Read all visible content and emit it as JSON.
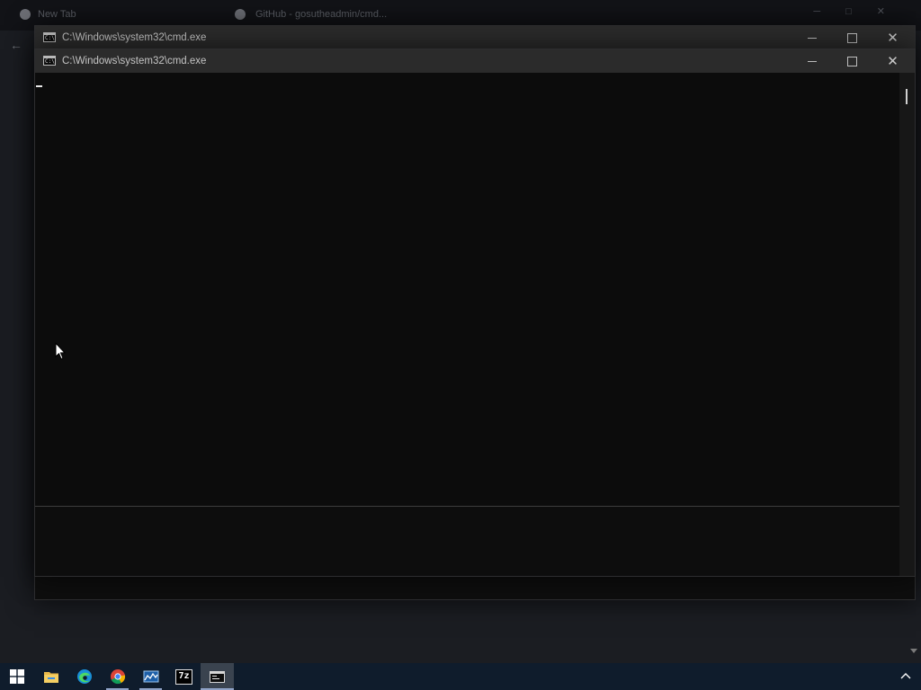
{
  "browser_bg": {
    "tabs": [
      {
        "title": "New Tab"
      },
      {
        "title": "GitHub - gosutheadmin/cmd..."
      }
    ]
  },
  "windows": [
    {
      "title": "C:\\Windows\\system32\\cmd.exe"
    },
    {
      "title": "C:\\Windows\\system32\\cmd.exe"
    }
  ],
  "taskbar": {
    "items": [
      {
        "name": "start",
        "icon": "windows-logo-icon",
        "active": false
      },
      {
        "name": "file-explorer",
        "icon": "folder-icon",
        "active": false
      },
      {
        "name": "edge",
        "icon": "edge-browser-icon",
        "active": false
      },
      {
        "name": "chrome",
        "icon": "chrome-browser-icon",
        "active": false
      },
      {
        "name": "resource-monitor",
        "icon": "monitor-chart-icon",
        "active": false
      },
      {
        "name": "7-zip",
        "icon": "7zip-icon",
        "label": "7z",
        "active": false
      },
      {
        "name": "cmd",
        "icon": "cmd-terminal-icon",
        "active": true
      }
    ]
  },
  "colors": {
    "console_bg": "#0c0c0c",
    "titlebar_bg": "#2b2b2b",
    "taskbar_bg": "#0f1c2c",
    "taskbar_indicator": "#8fa2c6"
  }
}
